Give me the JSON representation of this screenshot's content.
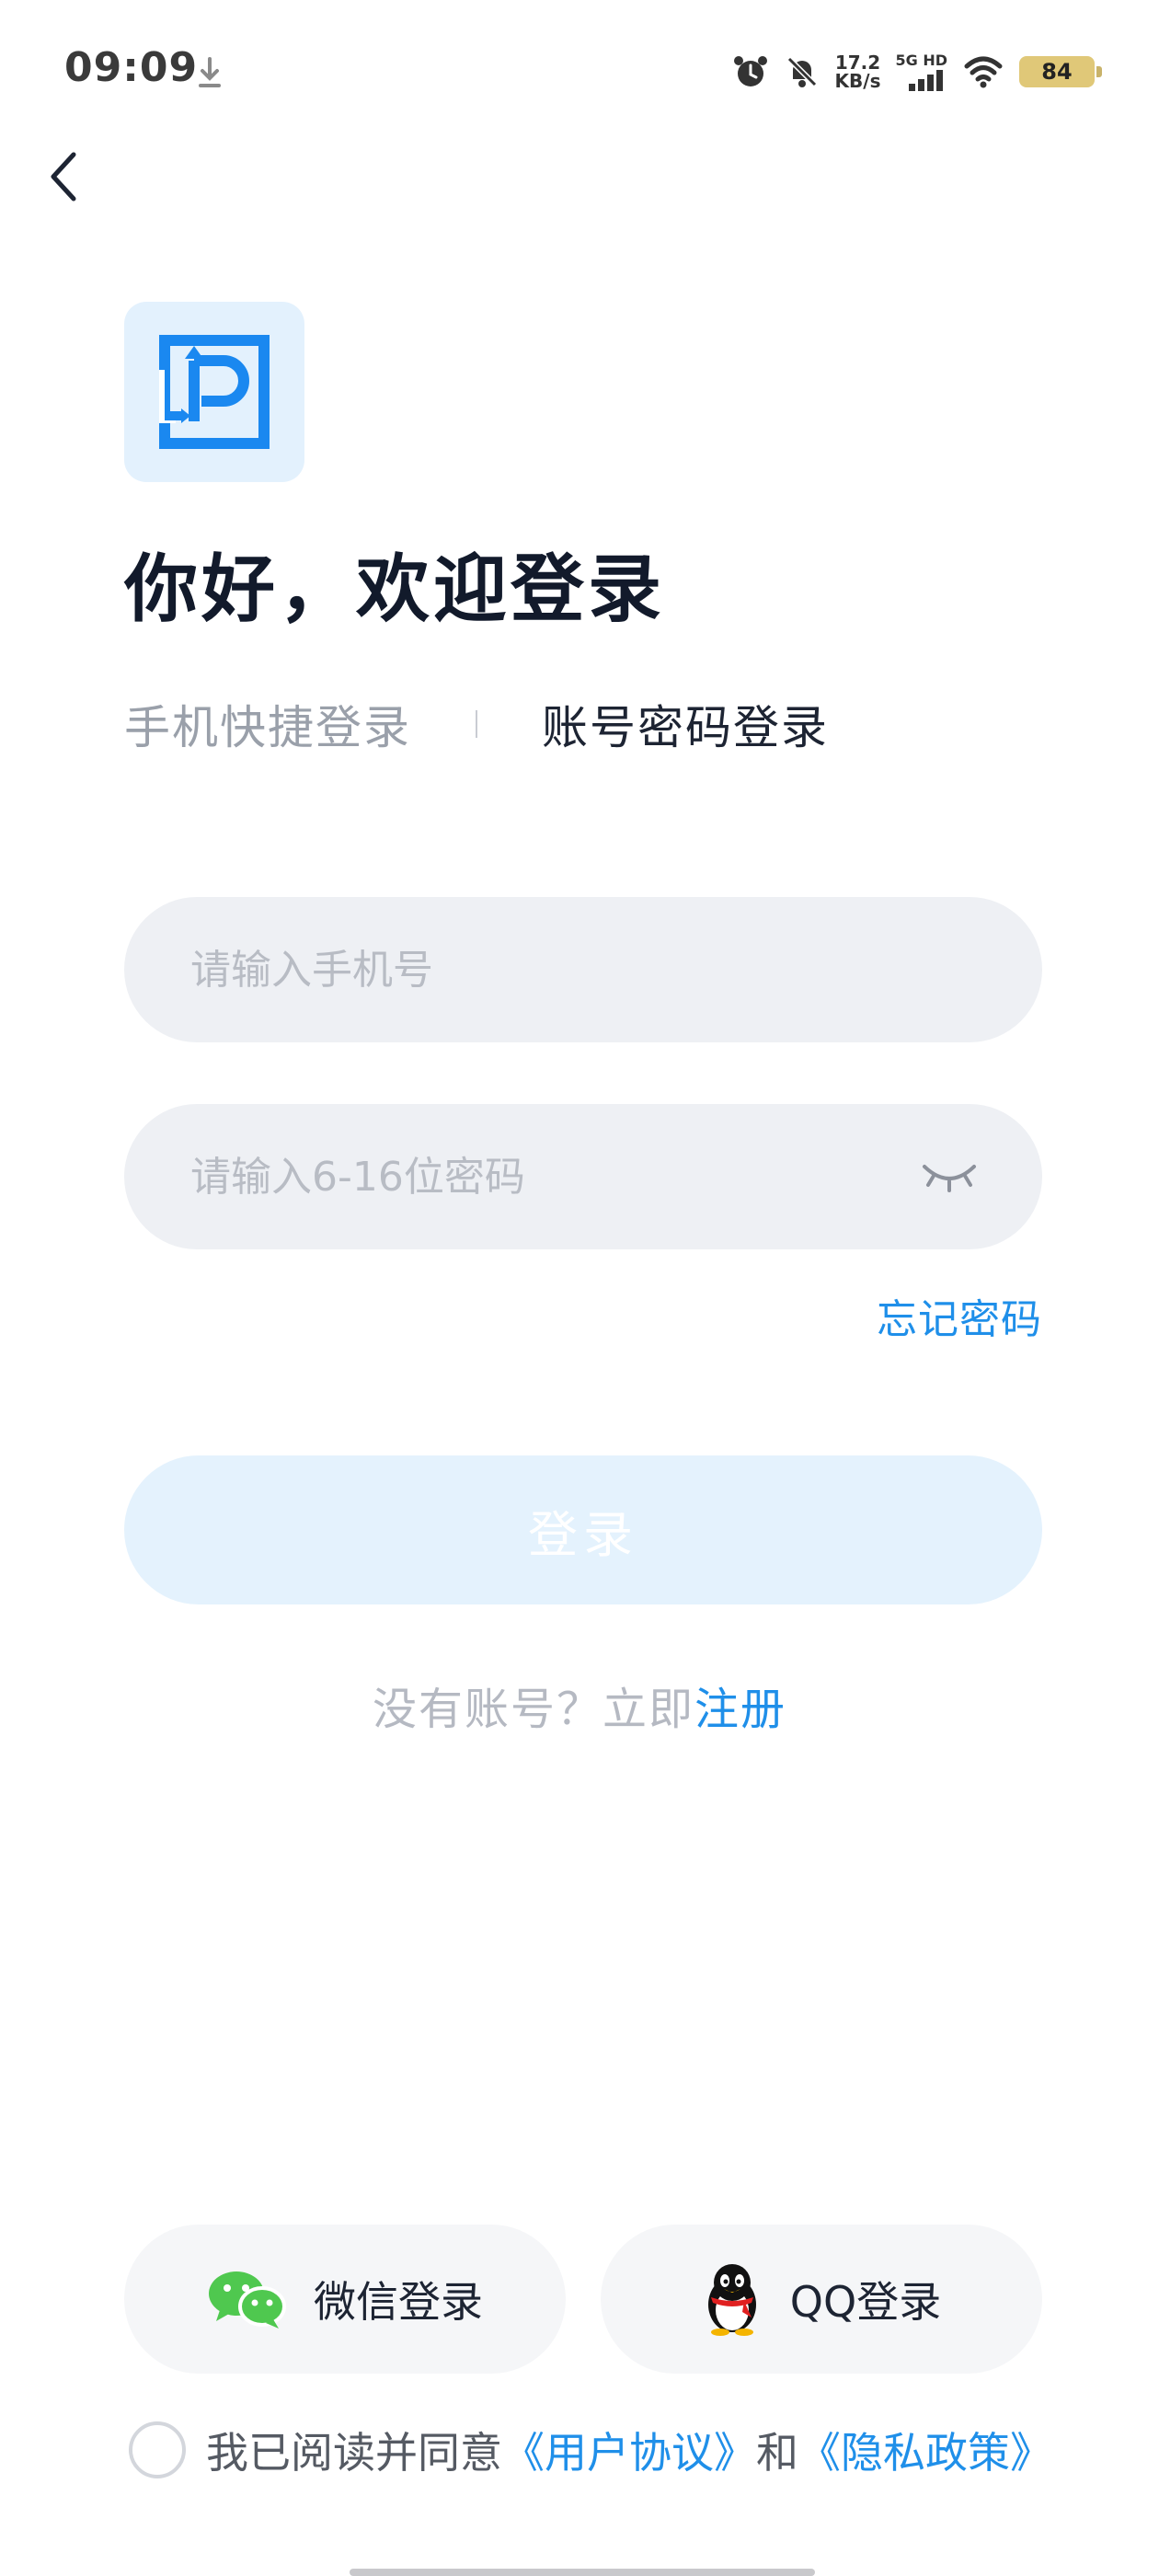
{
  "status_bar": {
    "time": "09:09",
    "net_speed_value": "17.2",
    "net_speed_unit": "KB/s",
    "network_label": "5G HD",
    "battery": "84"
  },
  "header": {
    "welcome": "你好，欢迎登录"
  },
  "tabs": [
    {
      "label": "手机快捷登录",
      "active": false
    },
    {
      "label": "账号密码登录",
      "active": true
    }
  ],
  "form": {
    "phone_placeholder": "请输入手机号",
    "password_placeholder": "请输入6-16位密码",
    "forgot_label": "忘记密码",
    "login_label": "登录"
  },
  "register": {
    "prompt": "没有账号？立即",
    "link": "注册"
  },
  "social": {
    "wechat_label": "微信登录",
    "qq_label": "QQ登录"
  },
  "agreement": {
    "prefix": "我已阅读并同意",
    "user_agreement": "《用户协议》",
    "and": "和",
    "privacy_policy": "《隐私政策》"
  },
  "colors": {
    "accent": "#1f8fe9",
    "login_disabled_bg": "#e4f2fd",
    "input_bg": "#eef0f4"
  }
}
